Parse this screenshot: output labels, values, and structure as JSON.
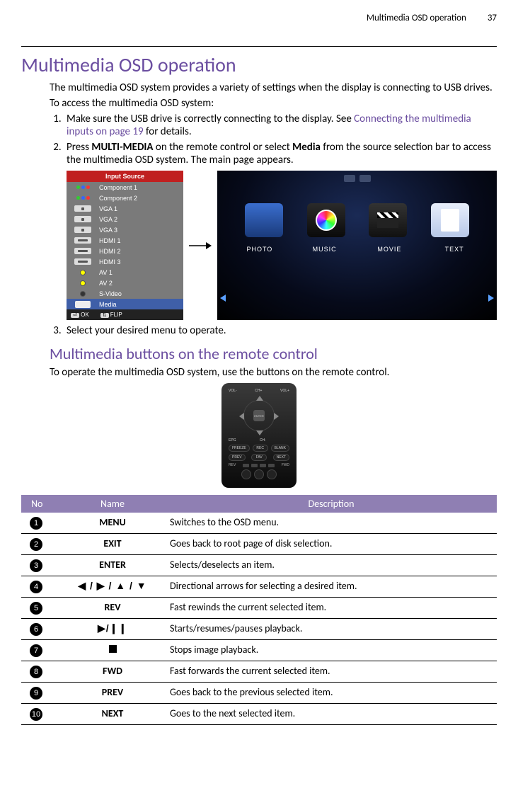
{
  "header": {
    "running_title": "Multimedia OSD operation",
    "page_number": "37"
  },
  "h1": "Multimedia OSD operation",
  "intro1": "The multimedia OSD system provides a variety of settings when the display is connecting to USB drives.",
  "intro2": "To access the multimedia OSD system:",
  "steps": {
    "s1_a": "Make sure the USB drive is correctly connecting to the display. See ",
    "s1_link": "Connecting the multimedia inputs on page 19",
    "s1_b": " for details.",
    "s2_a": "Press ",
    "s2_bold1": "MULTI-MEDIA",
    "s2_b": " on the remote control or select ",
    "s2_bold2": "Media",
    "s2_c": " from the source selection bar to access the multimedia OSD system. The main page appears.",
    "s3": "Select your desired menu to operate."
  },
  "input_source": {
    "title": "Input Source",
    "items": [
      "Component 1",
      "Component 2",
      "VGA 1",
      "VGA 2",
      "VGA 3",
      "HDMI 1",
      "HDMI 2",
      "HDMI 3",
      "AV 1",
      "AV 2",
      "S-Video",
      "Media"
    ],
    "footer_ok": "OK",
    "footer_flip": "FLIP"
  },
  "media_menu": {
    "items": [
      "PHOTO",
      "MUSIC",
      "MOVIE",
      "TEXT"
    ]
  },
  "h2": "Multimedia buttons on the remote control",
  "h2_intro": "To operate the multimedia OSD system, use the buttons on the remote control.",
  "remote_labels": {
    "vol_minus": "VOL-",
    "vol_plus": "VOL+",
    "ch_up": "CH+",
    "ch_dn": "CH-",
    "enter": "ENTER",
    "epg": "EPG",
    "freeze": "FREEZE",
    "rec": "REC",
    "blank": "BLANK",
    "prev": "PREV",
    "fav": "FAV",
    "next": "NEXT",
    "rev": "REV",
    "fwd": "FWD"
  },
  "table": {
    "headers": {
      "no": "No",
      "name": "Name",
      "desc": "Description"
    },
    "rows": [
      {
        "no": "1",
        "name": "MENU",
        "desc": "Switches to the OSD menu."
      },
      {
        "no": "2",
        "name": "EXIT",
        "desc": "Goes back to root page of disk selection."
      },
      {
        "no": "3",
        "name": "ENTER",
        "desc": "Selects/deselects an item."
      },
      {
        "no": "4",
        "name": "◀ / ▶ / ▲ / ▼",
        "desc": "Directional arrows for selecting a desired item."
      },
      {
        "no": "5",
        "name": "REV",
        "desc": "Fast rewinds the current selected item."
      },
      {
        "no": "6",
        "name": "▶/❙❙",
        "desc": "Starts/resumes/pauses playback."
      },
      {
        "no": "7",
        "name": "■",
        "desc": "Stops image playback."
      },
      {
        "no": "8",
        "name": "FWD",
        "desc": "Fast forwards the current selected item."
      },
      {
        "no": "9",
        "name": "PREV",
        "desc": "Goes back to the previous selected item."
      },
      {
        "no": "10",
        "name": "NEXT",
        "desc": "Goes to the next selected item."
      }
    ]
  }
}
